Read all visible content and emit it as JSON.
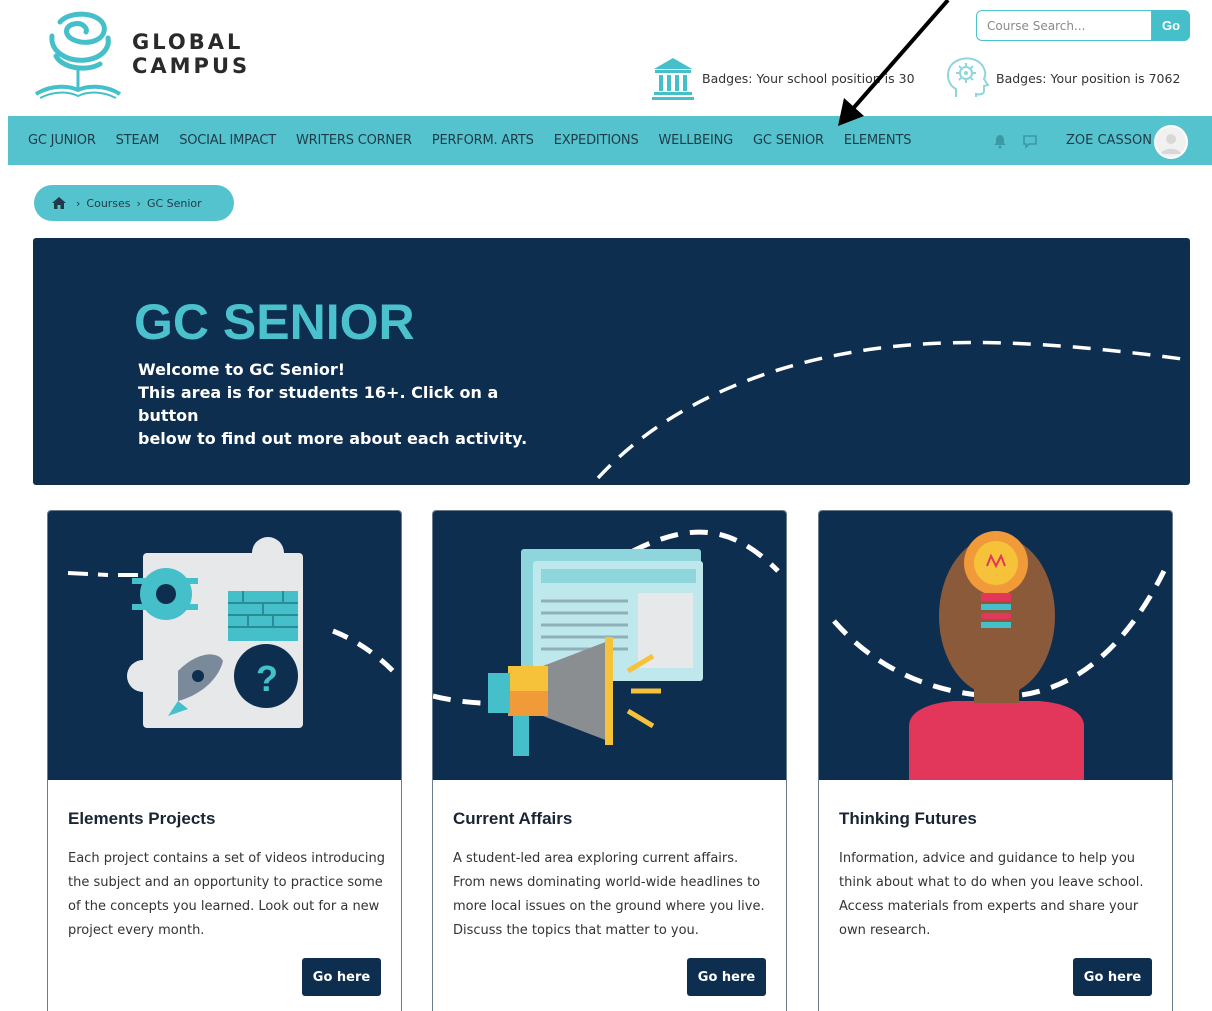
{
  "header": {
    "logo_line1": "GLOBAL",
    "logo_line2": "CAMPUS",
    "search": {
      "placeholder": "Course Search...",
      "button_label": "Go"
    },
    "badge_school": "Badges: Your school position is 30",
    "badge_user": "Badges: Your position is 7062"
  },
  "nav": {
    "items": [
      "GC JUNIOR",
      "STEAM",
      "SOCIAL IMPACT",
      "WRITERS CORNER",
      "PERFORM. ARTS",
      "EXPEDITIONS",
      "WELLBEING",
      "GC SENIOR",
      "ELEMENTS"
    ],
    "user_name": "ZOE CASSON"
  },
  "breadcrumb": {
    "items": [
      "Courses",
      "GC Senior"
    ]
  },
  "hero": {
    "title": "GC SENIOR",
    "line1": "Welcome to GC Senior!",
    "line2": "This area is for students 16+. Click on a button",
    "line3": "below to find out more about each activity."
  },
  "cards": [
    {
      "title": "Elements Projects",
      "text": "Each project contains a set of videos introducing the subject and an opportunity to practice some of the concepts you learned. Look out for a new project every month.",
      "button": "Go here"
    },
    {
      "title": "Current Affairs",
      "text": "A student-led area exploring current affairs. From news dominating world-wide headlines to more local issues on the ground where you live. Discuss the topics that matter to you.",
      "button": "Go here"
    },
    {
      "title": "Thinking Futures",
      "text": "Information, advice and guidance to help you think about what to do when you leave school. Access materials from experts and share your own research.",
      "button": "Go here"
    }
  ],
  "colors": {
    "teal": "#54c3cd",
    "navy": "#0e2e4f",
    "hero_title": "#4ac1cc"
  }
}
